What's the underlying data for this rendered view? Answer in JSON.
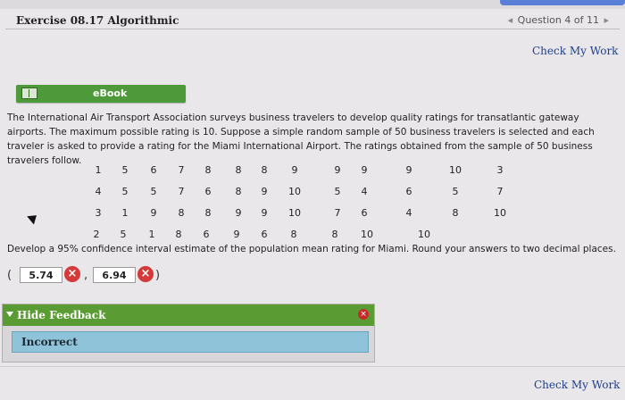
{
  "header": {
    "exercise_title": "Exercise 08.17 Algorithmic",
    "question_nav": "Question 4 of 11"
  },
  "actions": {
    "check_my_work_top": "Check My Work",
    "check_my_work_bottom": "Check My Work"
  },
  "ebook": {
    "label": "eBook"
  },
  "problem": {
    "text_1": "The International Air Transport Association surveys business travelers to develop quality ratings for transatlantic gateway airports. The maximum possible rating is 10. Suppose a simple random sample of 50 business travelers is selected and each traveler is asked to provide a rating for the Miami International Airport. The ratings obtained from the sample of 50 business travelers follow."
  },
  "ratings": [
    [
      "1",
      "5",
      "6",
      "7",
      "8",
      "8",
      "8",
      "9",
      "9",
      "9",
      "9",
      "10",
      "3"
    ],
    [
      "4",
      "5",
      "5",
      "7",
      "6",
      "8",
      "9",
      "10",
      "5",
      "4",
      "6",
      "5",
      "7"
    ],
    [
      "3",
      "1",
      "9",
      "8",
      "8",
      "9",
      "9",
      "10",
      "7",
      "6",
      "4",
      "8",
      "10"
    ],
    [
      "2",
      "5",
      "1",
      "8",
      "6",
      "9",
      "6",
      "8",
      "8",
      "10",
      "10"
    ]
  ],
  "question": {
    "text": "Develop a 95% confidence interval estimate of the population mean rating for Miami. Round your answers to two decimal places."
  },
  "answers": {
    "lower": "5.74",
    "upper": "6.94",
    "open_paren": "(",
    "comma": ",",
    "close_paren": ")"
  },
  "feedback": {
    "toggle_label": "Hide Feedback",
    "result": "Incorrect"
  },
  "colors": {
    "ebook_green": "#4e9a3a",
    "feedback_green": "#5a9b33",
    "feedback_blue": "#8fc3d9",
    "error_red": "#d43a3a",
    "link_blue": "#1d3f8c"
  }
}
